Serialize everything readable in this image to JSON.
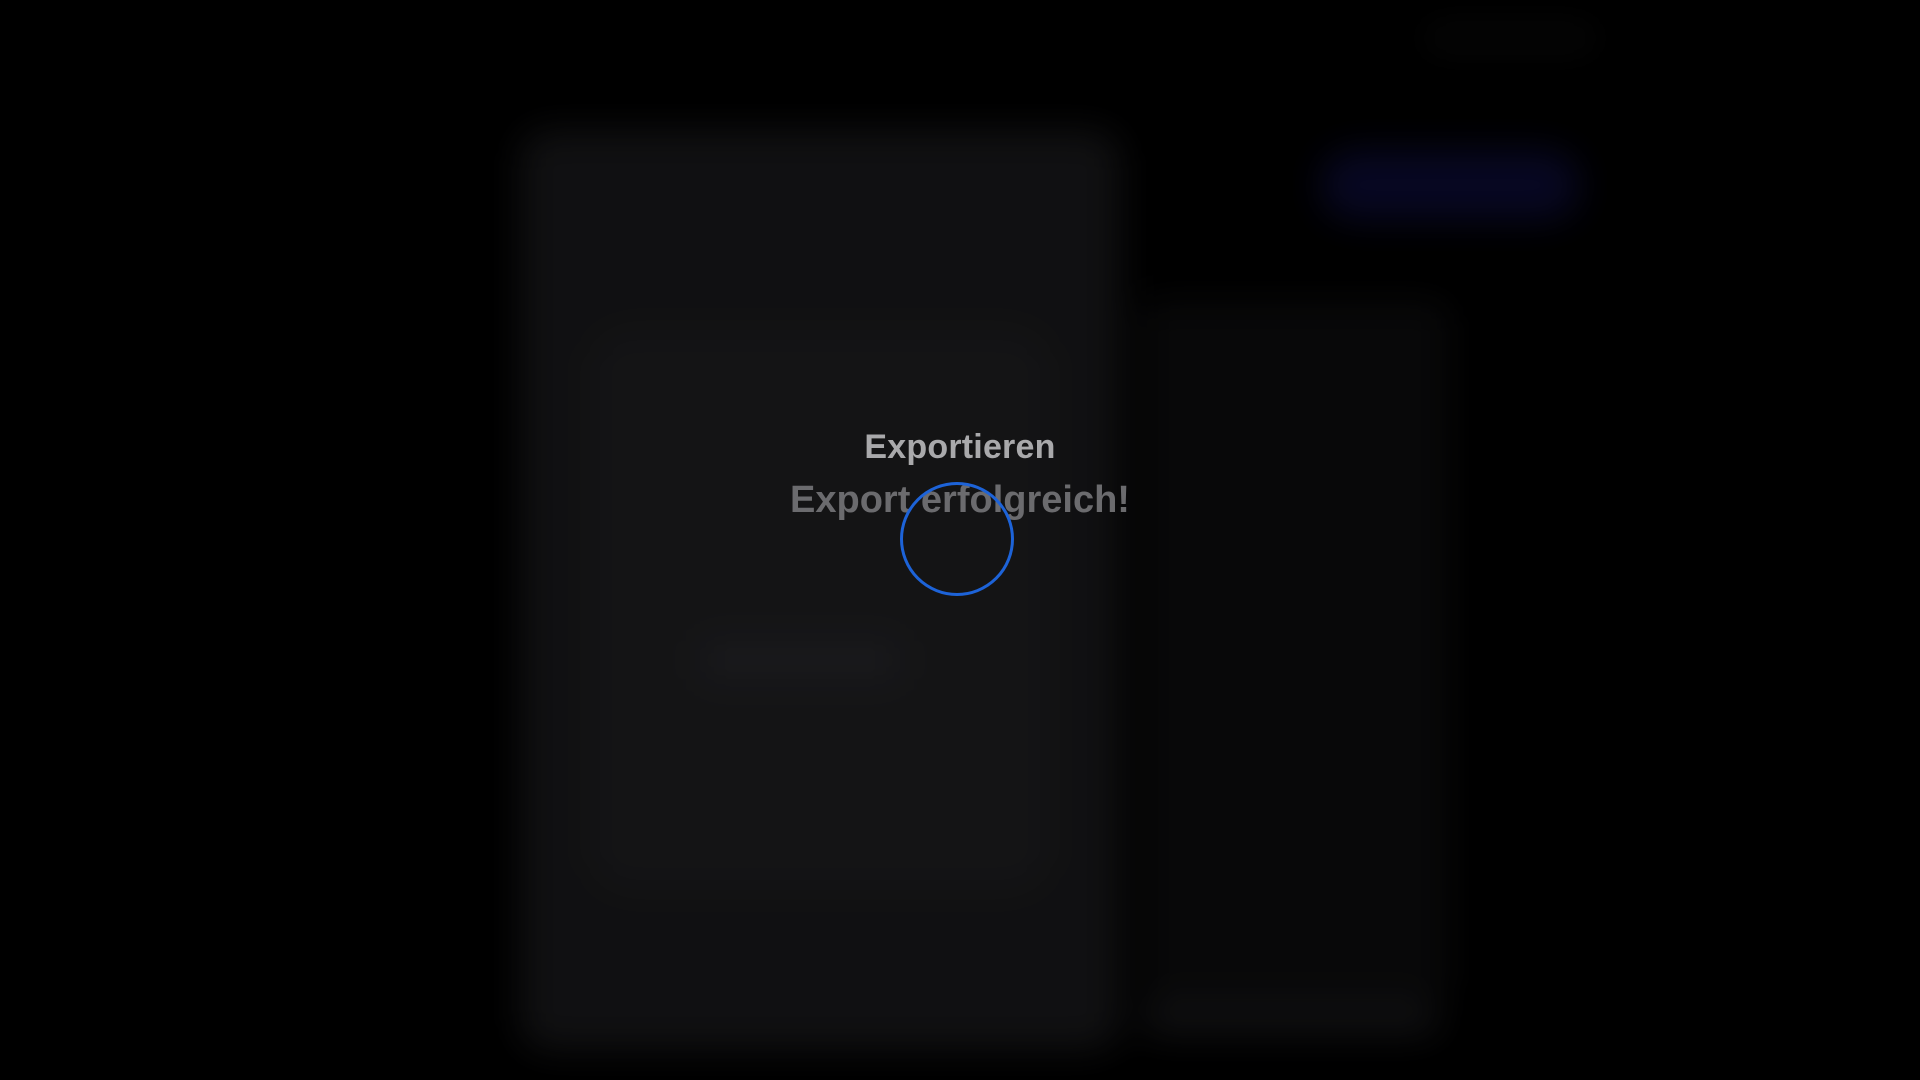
{
  "export_dialog": {
    "title": "Exportieren",
    "status": "Export erfolgreich!",
    "spinner_color": "#1d63d8",
    "progress_indicator": "circle-progress-icon"
  },
  "background": {
    "dimmed": true,
    "blurred": true,
    "accent_color": "#0a0a2e"
  }
}
